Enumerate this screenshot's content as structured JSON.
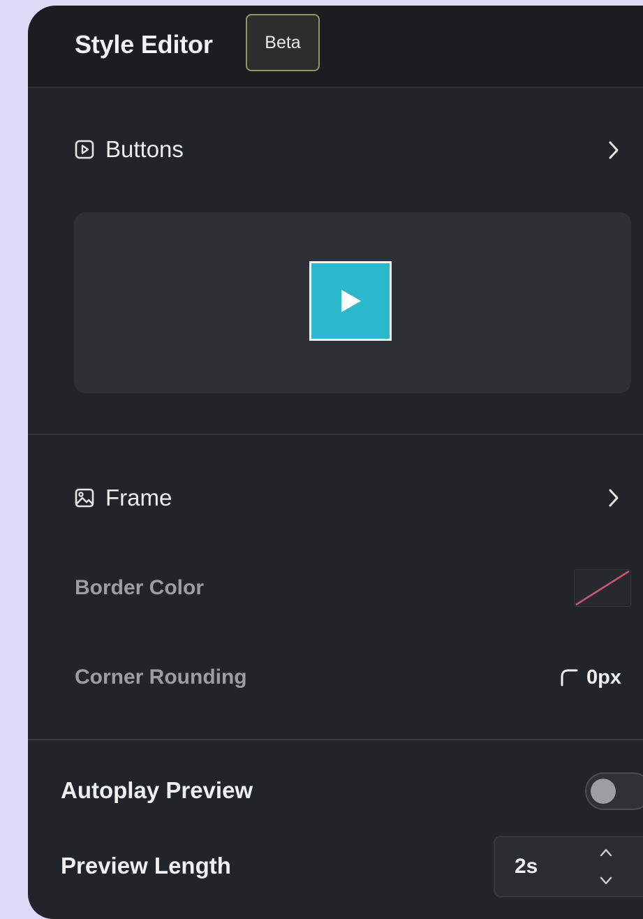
{
  "header": {
    "title": "Style Editor",
    "badge": "Beta"
  },
  "buttons_section": {
    "title": "Buttons",
    "icon": "play-square-icon",
    "preview_icon": "play-icon",
    "preview_button_color": "#2bb7cc"
  },
  "frame_section": {
    "title": "Frame",
    "icon": "image-icon",
    "border_color_label": "Border Color",
    "border_color_value": "none",
    "corner_rounding_label": "Corner Rounding",
    "corner_rounding_value": "0px"
  },
  "autoplay": {
    "label": "Autoplay Preview",
    "enabled": false
  },
  "preview_length": {
    "label": "Preview Length",
    "value": "2s"
  }
}
